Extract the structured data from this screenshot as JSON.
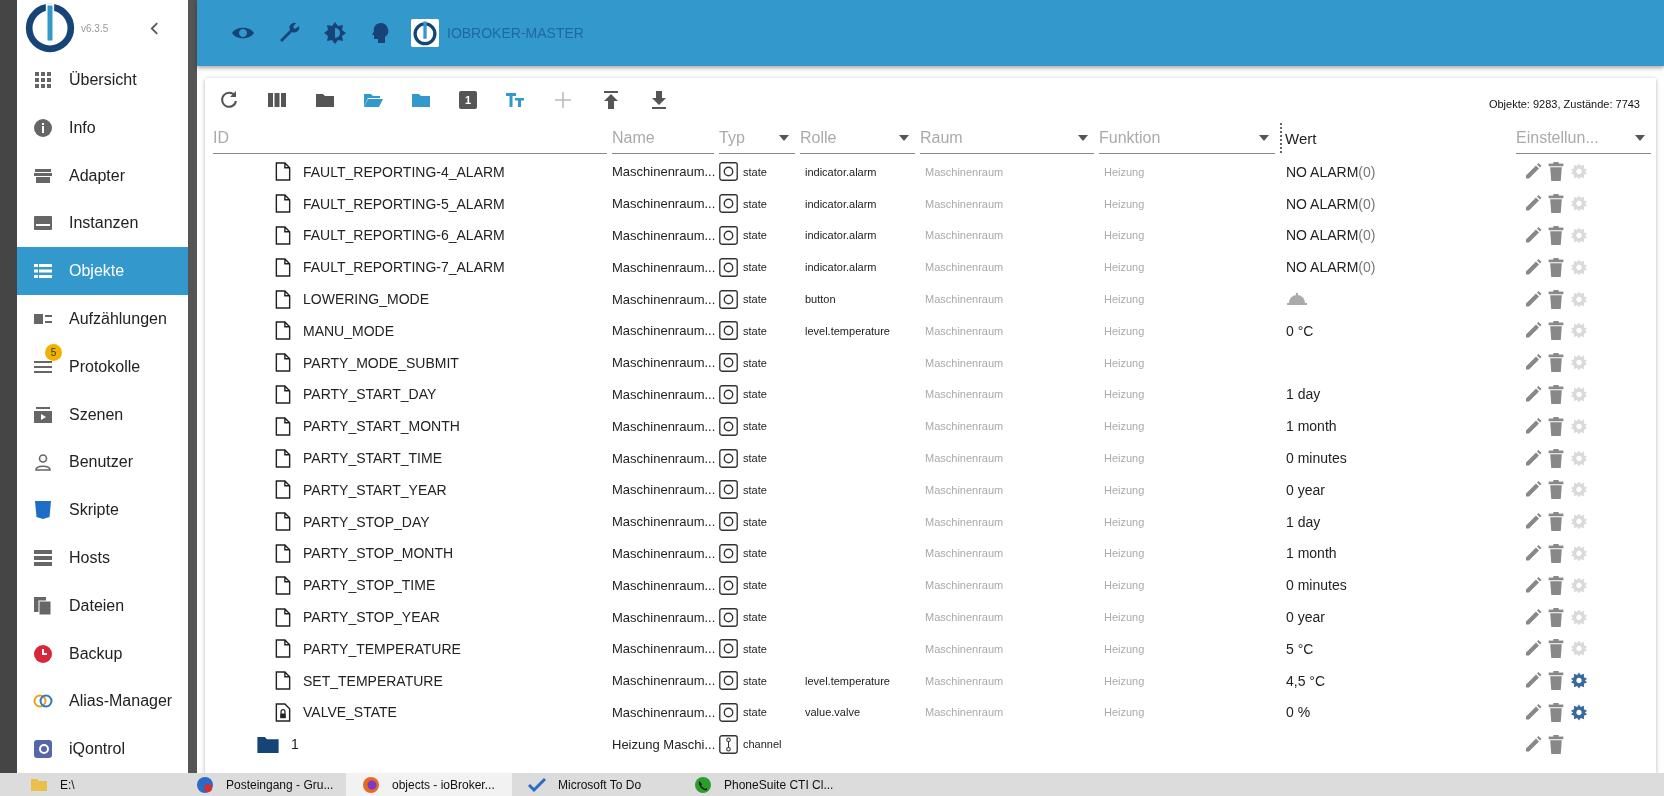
{
  "sidebar": {
    "version": "v6.3.5",
    "items": [
      {
        "label": "Übersicht",
        "selected": false
      },
      {
        "label": "Info",
        "selected": false
      },
      {
        "label": "Adapter",
        "selected": false
      },
      {
        "label": "Instanzen",
        "selected": false
      },
      {
        "label": "Objekte",
        "selected": true
      },
      {
        "label": "Aufzählungen",
        "selected": false
      },
      {
        "label": "Protokolle",
        "selected": false,
        "badge": "5"
      },
      {
        "label": "Szenen",
        "selected": false
      },
      {
        "label": "Benutzer",
        "selected": false
      },
      {
        "label": "Skripte",
        "selected": false
      },
      {
        "label": "Hosts",
        "selected": false
      },
      {
        "label": "Dateien",
        "selected": false
      },
      {
        "label": "Backup",
        "selected": false
      },
      {
        "label": "Alias-Manager",
        "selected": false
      },
      {
        "label": "iQontrol",
        "selected": false
      }
    ]
  },
  "topbar": {
    "title": "IOBROKER-MASTER"
  },
  "toolbar": {
    "counter": "1",
    "stats": "Objekte: 9283, Zustände: 7743"
  },
  "table": {
    "columns": [
      {
        "label": "ID",
        "kind": "filter"
      },
      {
        "label": "Name",
        "kind": "filter"
      },
      {
        "label": "Typ",
        "kind": "select"
      },
      {
        "label": "Rolle",
        "kind": "select"
      },
      {
        "label": "Raum",
        "kind": "select"
      },
      {
        "label": "Funktion",
        "kind": "select"
      },
      {
        "label": "Wert",
        "kind": "label"
      },
      {
        "label": "Einstellun...",
        "kind": "select"
      }
    ],
    "rows": [
      {
        "kind": "state",
        "id": "FAULT_REPORTING-4_ALARM",
        "read_only": false,
        "name": "Maschinenraum...",
        "type": "state",
        "role": "indicator.alarm",
        "room": "Maschinenraum",
        "function": "Heizung",
        "value": "NO ALARM",
        "value_note": "(0)",
        "custom": false
      },
      {
        "kind": "state",
        "id": "FAULT_REPORTING-5_ALARM",
        "read_only": false,
        "name": "Maschinenraum...",
        "type": "state",
        "role": "indicator.alarm",
        "room": "Maschinenraum",
        "function": "Heizung",
        "value": "NO ALARM",
        "value_note": "(0)",
        "custom": false
      },
      {
        "kind": "state",
        "id": "FAULT_REPORTING-6_ALARM",
        "read_only": false,
        "name": "Maschinenraum...",
        "type": "state",
        "role": "indicator.alarm",
        "room": "Maschinenraum",
        "function": "Heizung",
        "value": "NO ALARM",
        "value_note": "(0)",
        "custom": false
      },
      {
        "kind": "state",
        "id": "FAULT_REPORTING-7_ALARM",
        "read_only": false,
        "name": "Maschinenraum...",
        "type": "state",
        "role": "indicator.alarm",
        "room": "Maschinenraum",
        "function": "Heizung",
        "value": "NO ALARM",
        "value_note": "(0)",
        "custom": false
      },
      {
        "kind": "state",
        "id": "LOWERING_MODE",
        "read_only": false,
        "name": "Maschinenraum...",
        "type": "state",
        "role": "button",
        "room": "Maschinenraum",
        "function": "Heizung",
        "value_button": true,
        "custom": false
      },
      {
        "kind": "state",
        "id": "MANU_MODE",
        "read_only": false,
        "name": "Maschinenraum...",
        "type": "state",
        "role": "level.temperature",
        "room": "Maschinenraum",
        "function": "Heizung",
        "value": "0 °C",
        "custom": false
      },
      {
        "kind": "state",
        "id": "PARTY_MODE_SUBMIT",
        "read_only": false,
        "name": "Maschinenraum...",
        "type": "state",
        "room": "Maschinenraum",
        "function": "Heizung",
        "custom": false
      },
      {
        "kind": "state",
        "id": "PARTY_START_DAY",
        "read_only": false,
        "name": "Maschinenraum...",
        "type": "state",
        "room": "Maschinenraum",
        "function": "Heizung",
        "value": "1 day",
        "custom": false
      },
      {
        "kind": "state",
        "id": "PARTY_START_MONTH",
        "read_only": false,
        "name": "Maschinenraum...",
        "type": "state",
        "room": "Maschinenraum",
        "function": "Heizung",
        "value": "1 month",
        "custom": false
      },
      {
        "kind": "state",
        "id": "PARTY_START_TIME",
        "read_only": false,
        "name": "Maschinenraum...",
        "type": "state",
        "room": "Maschinenraum",
        "function": "Heizung",
        "value": "0 minutes",
        "custom": false
      },
      {
        "kind": "state",
        "id": "PARTY_START_YEAR",
        "read_only": false,
        "name": "Maschinenraum...",
        "type": "state",
        "room": "Maschinenraum",
        "function": "Heizung",
        "value": "0 year",
        "custom": false
      },
      {
        "kind": "state",
        "id": "PARTY_STOP_DAY",
        "read_only": false,
        "name": "Maschinenraum...",
        "type": "state",
        "room": "Maschinenraum",
        "function": "Heizung",
        "value": "1 day",
        "custom": false
      },
      {
        "kind": "state",
        "id": "PARTY_STOP_MONTH",
        "read_only": false,
        "name": "Maschinenraum...",
        "type": "state",
        "room": "Maschinenraum",
        "function": "Heizung",
        "value": "1 month",
        "custom": false
      },
      {
        "kind": "state",
        "id": "PARTY_STOP_TIME",
        "read_only": false,
        "name": "Maschinenraum...",
        "type": "state",
        "room": "Maschinenraum",
        "function": "Heizung",
        "value": "0 minutes",
        "custom": false
      },
      {
        "kind": "state",
        "id": "PARTY_STOP_YEAR",
        "read_only": false,
        "name": "Maschinenraum...",
        "type": "state",
        "room": "Maschinenraum",
        "function": "Heizung",
        "value": "0 year",
        "custom": false
      },
      {
        "kind": "state",
        "id": "PARTY_TEMPERATURE",
        "read_only": false,
        "name": "Maschinenraum...",
        "type": "state",
        "room": "Maschinenraum",
        "function": "Heizung",
        "value": "5 °C",
        "custom": false
      },
      {
        "kind": "state",
        "id": "SET_TEMPERATURE",
        "read_only": false,
        "name": "Maschinenraum...",
        "type": "state",
        "role": "level.temperature",
        "room": "Maschinenraum",
        "function": "Heizung",
        "value": "4,5 °C",
        "custom": true
      },
      {
        "kind": "state",
        "id": "VALVE_STATE",
        "read_only": true,
        "name": "Maschinenraum...",
        "type": "state",
        "role": "value.valve",
        "room": "Maschinenraum",
        "function": "Heizung",
        "value": "0 %",
        "custom": true
      },
      {
        "kind": "channel",
        "id": "1",
        "name": "Heizung Maschi...",
        "type": "channel"
      }
    ]
  },
  "taskbar": [
    {
      "label": "E:\\",
      "selected": false
    },
    {
      "label": "Posteingang - Gru...",
      "selected": false
    },
    {
      "label": "objects - ioBroker...",
      "selected": true
    },
    {
      "label": "Microsoft To Do",
      "selected": false
    },
    {
      "label": "PhoneSuite CTI Cl...",
      "selected": false
    }
  ]
}
